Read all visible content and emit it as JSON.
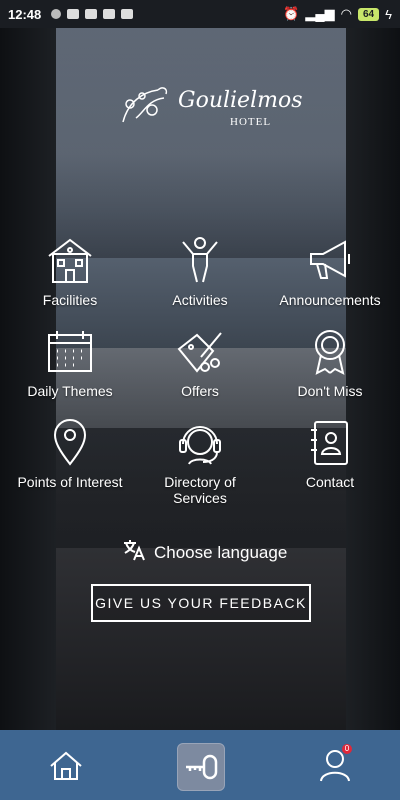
{
  "status_bar": {
    "time": "12:48",
    "battery": "64"
  },
  "logo": {
    "script_name": "Goulielmos",
    "subtitle": "HOTEL"
  },
  "menu": {
    "facilities": "Facilities",
    "activities": "Activities",
    "announcements": "Announcements",
    "daily_themes": "Daily Themes",
    "offers": "Offers",
    "dont_miss": "Don't Miss",
    "points_of_interest": "Points of Interest",
    "directory_line1": "Directory of",
    "directory_line2": "Services",
    "contact": "Contact"
  },
  "language": {
    "label": "Choose language"
  },
  "feedback": {
    "label": "GIVE US YOUR FEEDBACK"
  },
  "bottom_nav": {
    "badge_count": "0",
    "accent": "#3e6691",
    "badge_color": "#e0283a"
  }
}
